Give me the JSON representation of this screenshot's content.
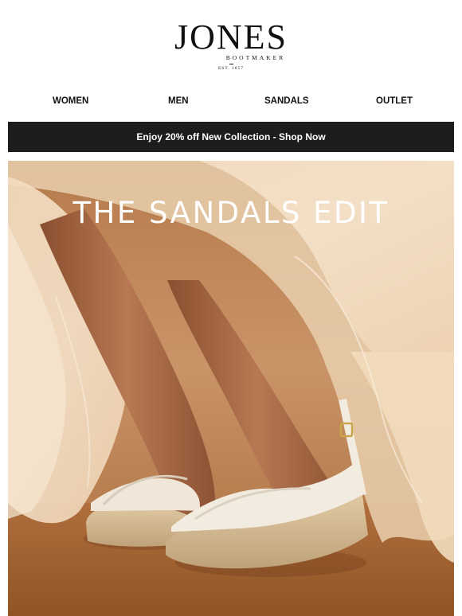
{
  "brand": {
    "name": "JONES",
    "tagline": "BOOTMAKER",
    "established": "EST. 1857"
  },
  "nav": {
    "items": [
      {
        "label": "WOMEN"
      },
      {
        "label": "MEN"
      },
      {
        "label": "SANDALS"
      },
      {
        "label": "OUTLET"
      }
    ]
  },
  "promo": {
    "text": "Enjoy 20% off New Collection - Shop Now",
    "background": "#1d1d1d",
    "color": "#ffffff"
  },
  "hero": {
    "title": "THE SANDALS EDIT",
    "image": "woman-wearing-espadrille-wedge-sandals-image"
  }
}
